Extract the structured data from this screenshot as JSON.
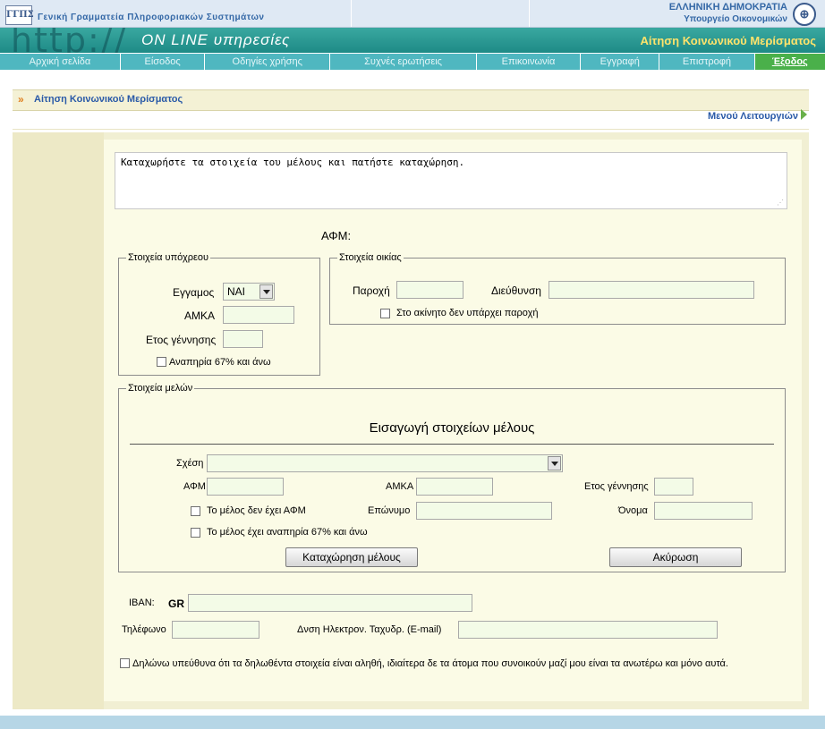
{
  "header": {
    "logo_text": "ΓΓΠΣ",
    "org_name": "Γενική Γραμματεία Πληροφοριακών Συστημάτων",
    "country": "ΕΛΛΗΝΙΚΗ ΔΗΜΟΚΡΑΤΙΑ",
    "ministry": "Υπουργείο Οικονομικών",
    "seal_icon": "hellenic-seal-icon"
  },
  "banner": {
    "http_text": "http://",
    "online_text": "ON LINE υπηρεσίες",
    "app_title": "Αίτηση Κοινωνικού Μερίσματος"
  },
  "nav": {
    "items": [
      {
        "label": "Αρχική σελίδα"
      },
      {
        "label": "Είσοδος"
      },
      {
        "label": "Οδηγίες χρήσης"
      },
      {
        "label": "Συχνές ερωτήσεις"
      },
      {
        "label": "Επικοινωνία"
      },
      {
        "label": "Εγγραφή"
      },
      {
        "label": "Επιστροφή"
      },
      {
        "label": "Έξοδος"
      }
    ]
  },
  "page": {
    "panel_title": "Αίτηση Κοινωνικού Μερίσματος",
    "menu_link": "Μενού Λειτουργιών"
  },
  "form": {
    "message": "Καταχωρήστε τα στοιχεία του μέλους και πατήστε καταχώρηση.",
    "afm_label": "ΑΦΜ:",
    "obligor": {
      "legend": "Στοιχεία υπόχρεου",
      "married_label": "Εγγαμος",
      "married_value": "ΝΑΙ",
      "amka_label": "ΑΜΚΑ",
      "birth_year_label": "Ετος γέννησης",
      "disability_label": "Αναπηρία 67% και άνω"
    },
    "residence": {
      "legend": "Στοιχεία οικίας",
      "supply_label": "Παροχή",
      "address_label": "Διεύθυνση",
      "no_supply_label": "Στο ακίνητο δεν υπάρχει παροχή"
    },
    "members": {
      "legend": "Στοιχεία μελών",
      "title": "Εισαγωγή στοιχείων μέλους",
      "relation_label": "Σχέση",
      "afm_label": "ΑΦΜ",
      "amka_label": "ΑΜΚΑ",
      "birth_year_label": "Ετος γέννησης",
      "no_afm_label": "Το μέλος δεν έχει ΑΦΜ",
      "surname_label": "Επώνυμο",
      "name_label": "Όνομα",
      "disability_label": "Το μέλος έχει αναπηρία 67% και άνω",
      "save_button": "Καταχώρηση μέλους",
      "cancel_button": "Ακύρωση"
    },
    "iban_label": "IBAN:",
    "iban_prefix": "GR",
    "phone_label": "Τηλέφωνο",
    "email_label": "Δνση Ηλεκτρον. Ταχυδρ. (E-mail)",
    "declaration": "Δηλώνω υπεύθυνα ότι τα δηλωθέντα στοιχεία είναι αληθή, ιδιαίτερα δε τα άτομα που συνοικούν μαζί μου είναι τα ανωτέρω και μόνο αυτά."
  }
}
